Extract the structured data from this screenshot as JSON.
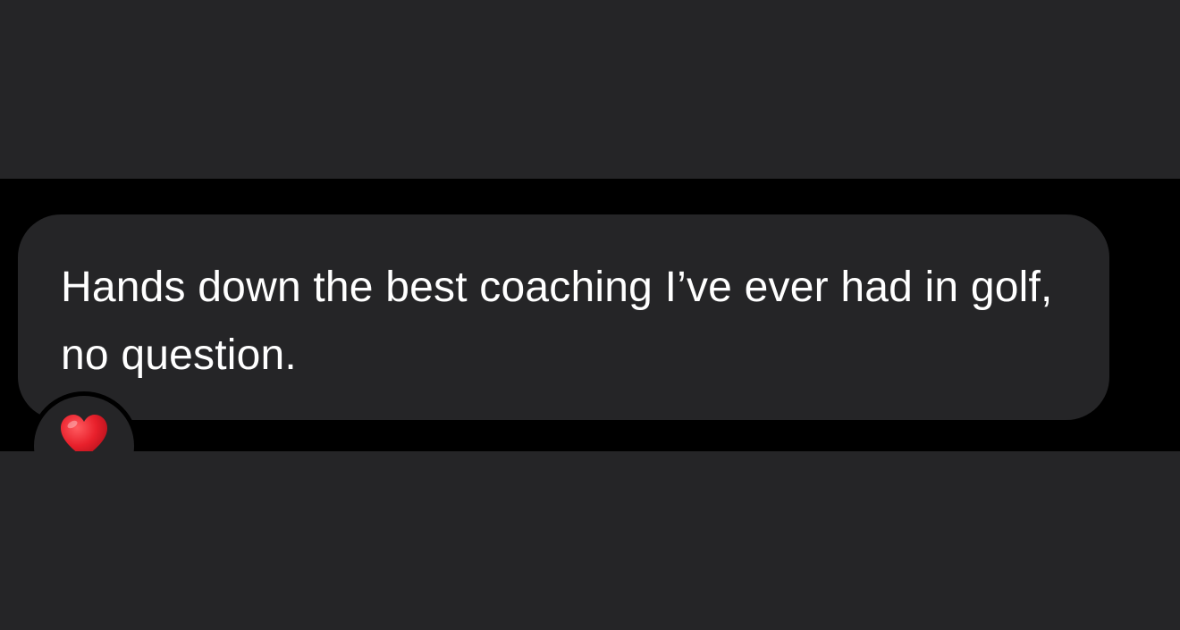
{
  "message": {
    "text": "Hands down the best coaching I’ve ever had in golf, no question."
  },
  "reaction": {
    "icon": "red-heart-icon",
    "color": "#e8202b"
  },
  "colors": {
    "background": "#252527",
    "strip": "#000000",
    "bubble": "#252527",
    "text": "#ffffff"
  }
}
